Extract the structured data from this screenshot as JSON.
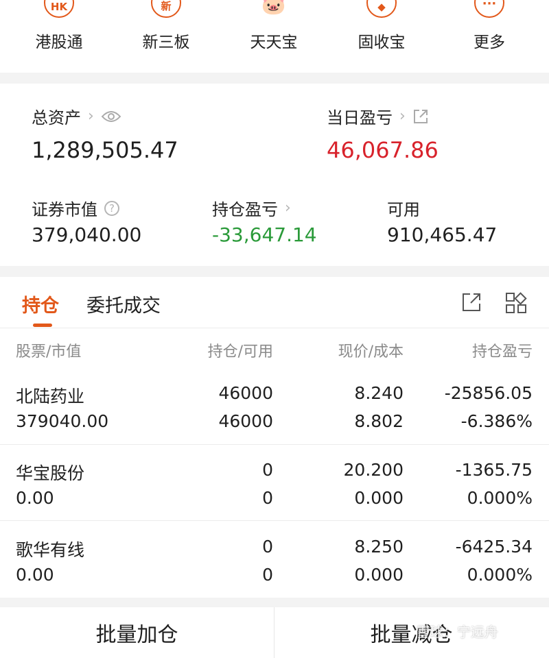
{
  "menu": [
    {
      "label": "港股通",
      "icon": "hk-icon",
      "glyph": "HK"
    },
    {
      "label": "新三板",
      "icon": "new-board-icon",
      "glyph": "新"
    },
    {
      "label": "天天宝",
      "icon": "piggy-bank-icon",
      "glyph": "🐷"
    },
    {
      "label": "固收宝",
      "icon": "fixed-income-icon",
      "glyph": "◆"
    },
    {
      "label": "更多",
      "icon": "more-icon",
      "glyph": "···"
    }
  ],
  "assets": {
    "total_label": "总资产",
    "total_value": "1,289,505.47",
    "daily_label": "当日盈亏",
    "daily_value": "46,067.86",
    "market_label": "证券市值",
    "market_value": "379,040.00",
    "position_pnl_label": "持仓盈亏",
    "position_pnl_value": "-33,647.14",
    "available_label": "可用",
    "available_value": "910,465.47"
  },
  "tabs": {
    "holdings": "持仓",
    "orders": "委托成交"
  },
  "table": {
    "headers": [
      "股票/市值",
      "持仓/可用",
      "现价/成本",
      "持仓盈亏"
    ],
    "rows": [
      {
        "name": "北陆药业",
        "market_value": "379040.00",
        "position": "46000",
        "available": "46000",
        "price": "8.240",
        "cost": "8.802",
        "pnl": "-25856.05",
        "pnl_pct": "-6.386%"
      },
      {
        "name": "华宝股份",
        "market_value": "0.00",
        "position": "0",
        "available": "0",
        "price": "20.200",
        "cost": "0.000",
        "pnl": "-1365.75",
        "pnl_pct": "0.000%"
      },
      {
        "name": "歌华有线",
        "market_value": "0.00",
        "position": "0",
        "available": "0",
        "price": "8.250",
        "cost": "0.000",
        "pnl": "-6425.34",
        "pnl_pct": "0.000%"
      }
    ]
  },
  "bottom": {
    "add": "批量加仓",
    "reduce": "批量减仓"
  },
  "watermark": "雪球：宁远舟",
  "colors": {
    "accent": "#e2581a",
    "up": "#d8222b",
    "down": "#2a9a39"
  }
}
